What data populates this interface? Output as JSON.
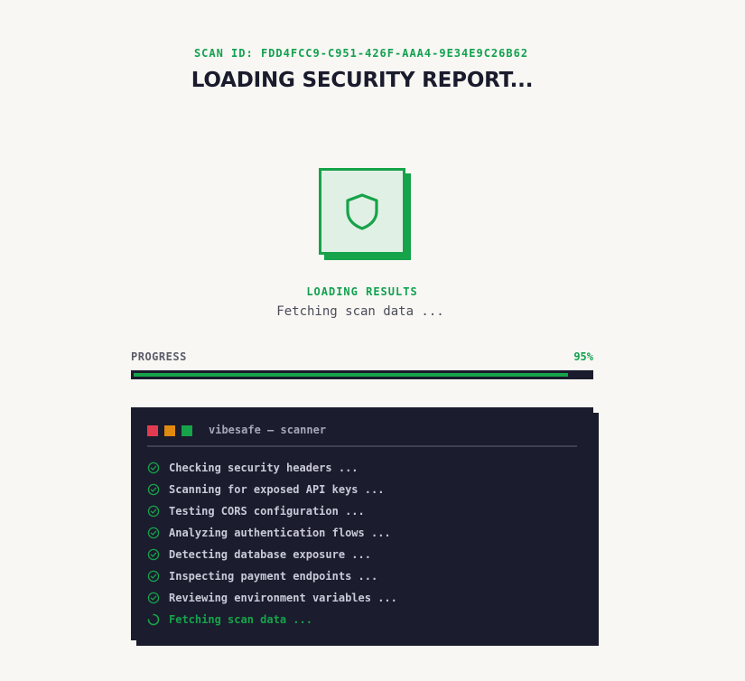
{
  "header": {
    "scan_id": "SCAN ID: FDD4FCC9-C951-426F-AAA4-9E34E9C26B62",
    "title": "LOADING SECURITY REPORT..."
  },
  "status": {
    "icon": "shield-icon",
    "label": "LOADING RESULTS",
    "subtitle": "Fetching scan data ..."
  },
  "progress": {
    "label": "PROGRESS",
    "value_text": "95%",
    "value": 0.95
  },
  "terminal": {
    "title": "vibesafe — scanner",
    "lines": [
      {
        "text": "Checking security headers ...",
        "state": "done"
      },
      {
        "text": "Scanning for exposed API keys ...",
        "state": "done"
      },
      {
        "text": "Testing CORS configuration ...",
        "state": "done"
      },
      {
        "text": "Analyzing authentication flows ...",
        "state": "done"
      },
      {
        "text": "Detecting database exposure ...",
        "state": "done"
      },
      {
        "text": "Inspecting payment endpoints ...",
        "state": "done"
      },
      {
        "text": "Reviewing environment variables ...",
        "state": "done"
      },
      {
        "text": "Fetching scan data ...",
        "state": "active"
      }
    ]
  },
  "colors": {
    "accent": "#16a34a",
    "background": "#f8f7f3",
    "terminal_bg": "#1b1c2e",
    "dot_red": "#e23b51",
    "dot_orange": "#e08a12",
    "dot_green": "#16a34a"
  }
}
